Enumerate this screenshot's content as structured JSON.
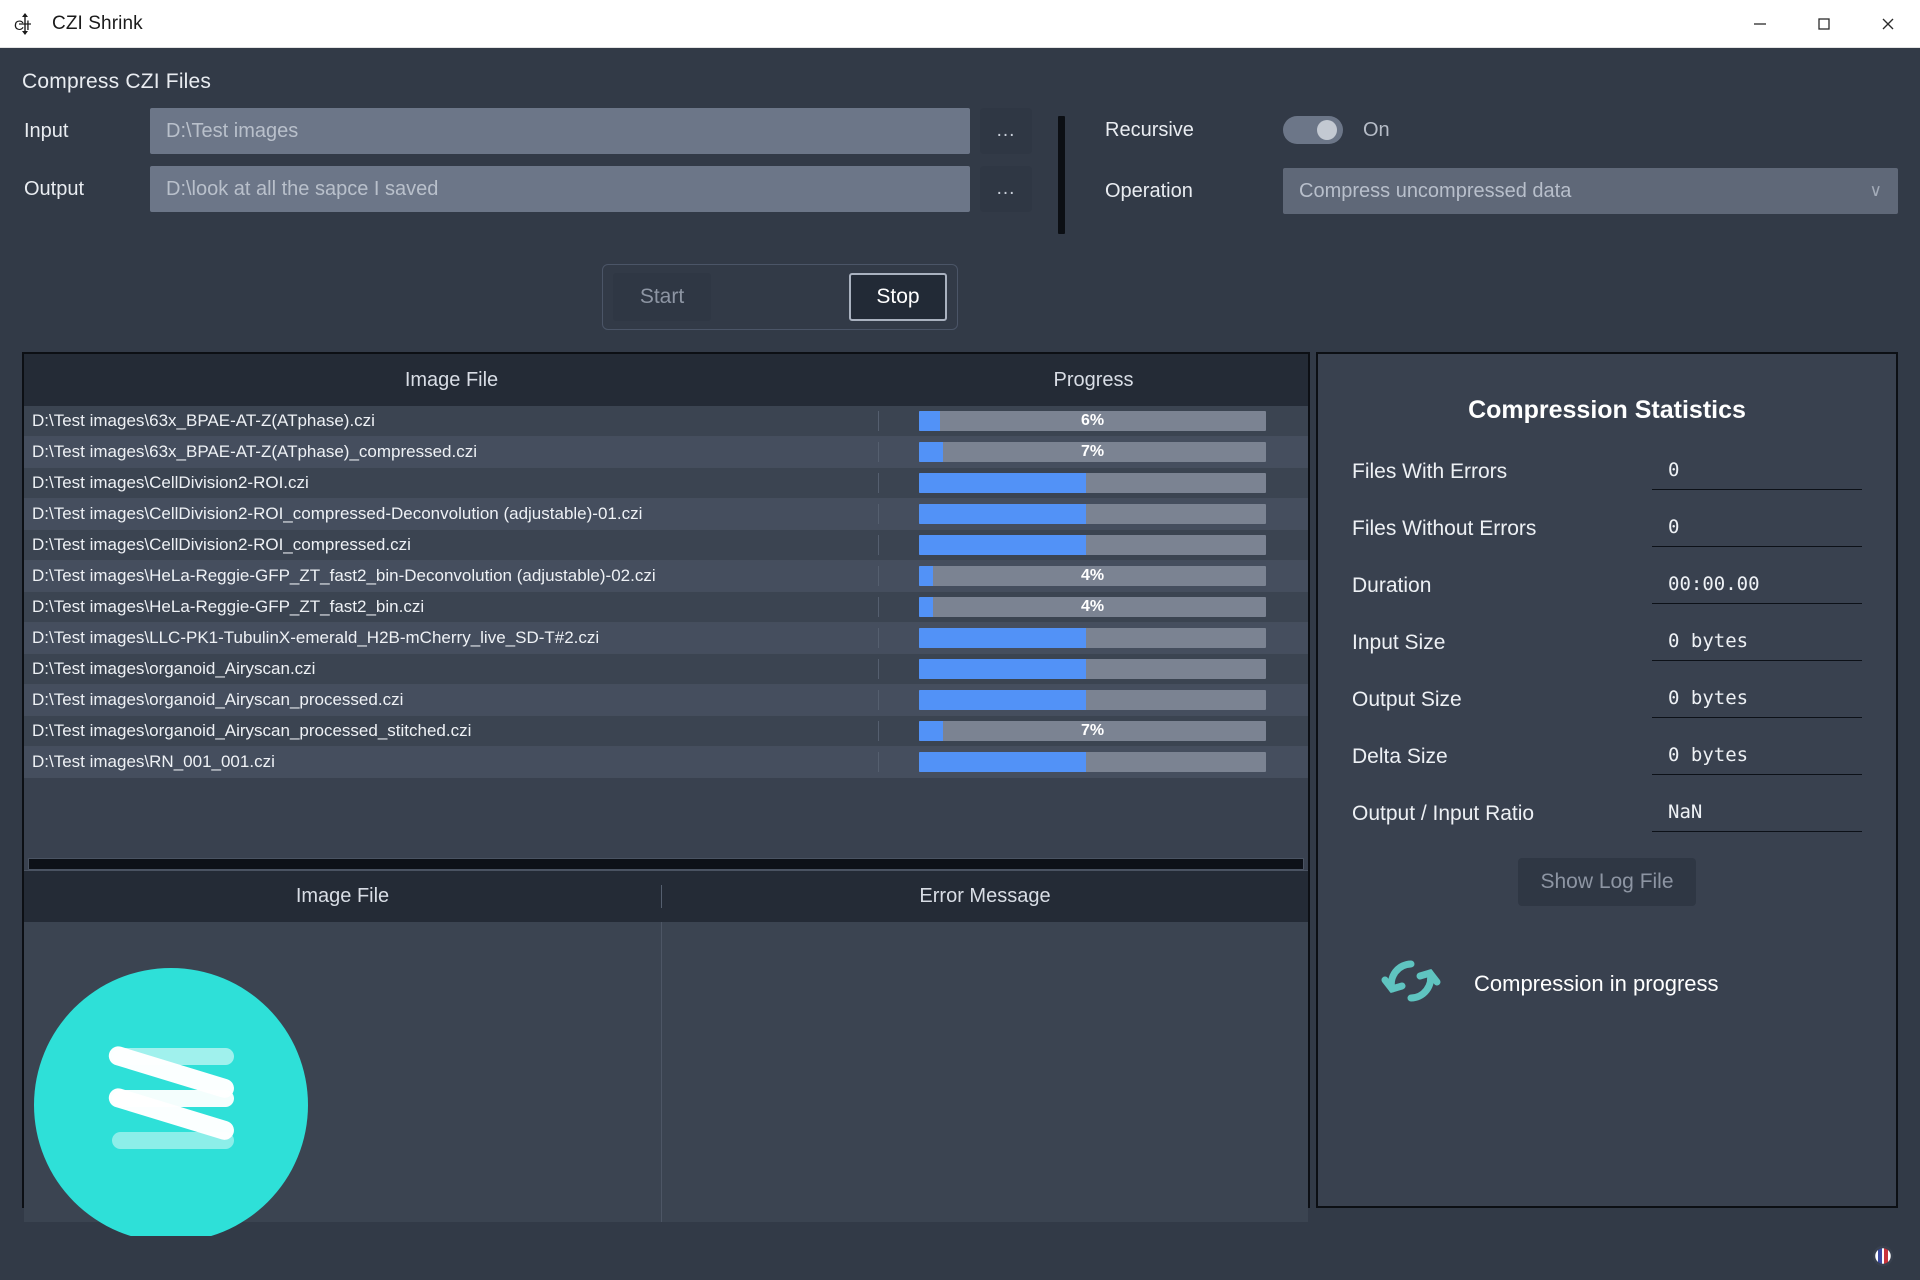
{
  "window": {
    "title": "CZI Shrink",
    "app_icon": "czi-logo-icon",
    "minimize_label": "–",
    "maximize_label": "□",
    "close_label": "✕"
  },
  "header": {
    "section_title": "Compress CZI Files"
  },
  "form": {
    "input_label": "Input",
    "input_value": "D:\\Test images",
    "input_placeholder": "D:\\Test images",
    "output_label": "Output",
    "output_value": "D:\\look at all the sapce I saved",
    "output_placeholder": "D:\\look at all the sapce I saved",
    "browse_label": "...",
    "recursive_label": "Recursive",
    "recursive_state": "On",
    "recursive_on": true,
    "operation_label": "Operation",
    "operation_value": "Compress uncompressed data",
    "operation_chevron": "∨"
  },
  "actions": {
    "start_label": "Start",
    "start_enabled": false,
    "stop_label": "Stop",
    "stop_enabled": true
  },
  "file_table": {
    "columns": [
      "Image File",
      "Progress"
    ],
    "rows": [
      {
        "file": "D:\\Test images\\63x_BPAE-AT-Z(ATphase).czi",
        "percent": 6,
        "label": "6%",
        "indeterminate": false
      },
      {
        "file": "D:\\Test images\\63x_BPAE-AT-Z(ATphase)_compressed.czi",
        "percent": 7,
        "label": "7%",
        "indeterminate": false
      },
      {
        "file": "D:\\Test images\\CellDivision2-ROI.czi",
        "percent": 48,
        "label": "",
        "indeterminate": true
      },
      {
        "file": "D:\\Test images\\CellDivision2-ROI_compressed-Deconvolution (adjustable)-01.czi",
        "percent": 48,
        "label": "",
        "indeterminate": true
      },
      {
        "file": "D:\\Test images\\CellDivision2-ROI_compressed.czi",
        "percent": 48,
        "label": "",
        "indeterminate": true
      },
      {
        "file": "D:\\Test images\\HeLa-Reggie-GFP_ZT_fast2_bin-Deconvolution (adjustable)-02.czi",
        "percent": 4,
        "label": "4%",
        "indeterminate": false
      },
      {
        "file": "D:\\Test images\\HeLa-Reggie-GFP_ZT_fast2_bin.czi",
        "percent": 4,
        "label": "4%",
        "indeterminate": false
      },
      {
        "file": "D:\\Test images\\LLC-PK1-TubulinX-emerald_H2B-mCherry_live_SD-T#2.czi",
        "percent": 48,
        "label": "",
        "indeterminate": true
      },
      {
        "file": "D:\\Test images\\organoid_Airyscan.czi",
        "percent": 48,
        "label": "",
        "indeterminate": true
      },
      {
        "file": "D:\\Test images\\organoid_Airyscan_processed.czi",
        "percent": 48,
        "label": "",
        "indeterminate": true
      },
      {
        "file": "D:\\Test images\\organoid_Airyscan_processed_stitched.czi",
        "percent": 7,
        "label": "7%",
        "indeterminate": false
      },
      {
        "file": "D:\\Test images\\RN_001_001.czi",
        "percent": 48,
        "label": "",
        "indeterminate": true
      }
    ]
  },
  "error_table": {
    "columns": [
      "Image File",
      "Error Message"
    ],
    "rows": []
  },
  "stats": {
    "title": "Compression Statistics",
    "items": [
      {
        "label": "Files With Errors",
        "value": "0"
      },
      {
        "label": "Files Without Errors",
        "value": "0"
      },
      {
        "label": "Duration",
        "value": "00:00.00"
      },
      {
        "label": "Input Size",
        "value": "0 bytes"
      },
      {
        "label": "Output Size",
        "value": "0 bytes"
      },
      {
        "label": "Delta Size",
        "value": "0 bytes"
      },
      {
        "label": "Output / Input Ratio",
        "value": "NaN"
      }
    ],
    "log_button_label": "Show Log File",
    "log_button_enabled": false,
    "status_icon": "refresh-sync-icon",
    "status_text": "Compression in progress"
  },
  "colors": {
    "accent_teal": "#2ee0d8",
    "progress_blue": "#5292f7",
    "panel_bg": "#39414f",
    "window_bg": "#323a47",
    "header_bg": "#242b36"
  },
  "statusbar": {
    "indicator_icon": "info-circle-icon"
  }
}
